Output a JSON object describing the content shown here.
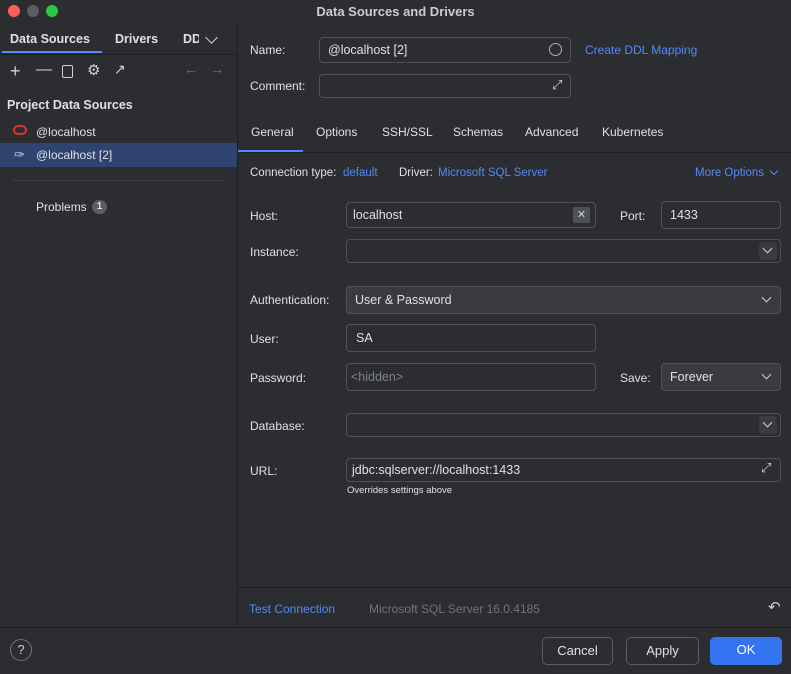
{
  "window": {
    "title": "Data Sources and Drivers"
  },
  "left": {
    "tabs": [
      "Data Sources",
      "Drivers",
      "DD"
    ],
    "section_title": "Project Data Sources",
    "sources": [
      {
        "label": "@localhost",
        "icon": "oracle-icon"
      },
      {
        "label": "@localhost [2]",
        "icon": "sqlserver-icon",
        "selected": true
      }
    ],
    "problems_label": "Problems",
    "problems_count": "1"
  },
  "form": {
    "name_label": "Name:",
    "name_value": "@localhost [2]",
    "create_ddl": "Create DDL Mapping",
    "comment_label": "Comment:",
    "tabs": [
      "General",
      "Options",
      "SSH/SSL",
      "Schemas",
      "Advanced",
      "Kubernetes"
    ],
    "active_tab": "General",
    "connection_type_label": "Connection type:",
    "connection_type_value": "default",
    "driver_label": "Driver:",
    "driver_value": "Microsoft SQL Server",
    "more_options": "More Options",
    "host_label": "Host:",
    "host_value": "localhost",
    "port_label": "Port:",
    "port_value": "1433",
    "instance_label": "Instance:",
    "auth_label": "Authentication:",
    "auth_value": "User & Password",
    "user_label": "User:",
    "user_value": "SA",
    "password_label": "Password:",
    "password_placeholder": "<hidden>",
    "save_label": "Save:",
    "save_value": "Forever",
    "database_label": "Database:",
    "url_label": "URL:",
    "url_value": "jdbc:sqlserver://localhost:1433",
    "url_hint": "Overrides settings above"
  },
  "footer": {
    "test_connection": "Test Connection",
    "server_version": "Microsoft SQL Server 16.0.4185",
    "help": "?",
    "cancel": "Cancel",
    "apply": "Apply",
    "ok": "OK"
  },
  "colors": {
    "accent": "#548af7",
    "ok_button": "#3574f0",
    "selected_row": "#2e436e",
    "close": "#ff5f57",
    "minimize": "#febc2e",
    "maximize": "#28c840"
  }
}
